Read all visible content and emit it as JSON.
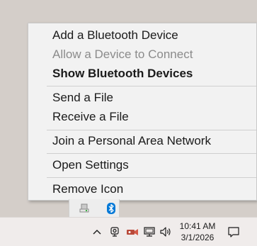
{
  "context_menu": {
    "items": [
      {
        "label": "Add a Bluetooth Device",
        "state": "enabled"
      },
      {
        "label": "Allow a Device to Connect",
        "state": "disabled"
      },
      {
        "label": "Show Bluetooth Devices",
        "state": "default"
      },
      {
        "label": "Send a File",
        "state": "enabled"
      },
      {
        "label": "Receive a File",
        "state": "enabled"
      },
      {
        "label": "Join a Personal Area Network",
        "state": "enabled"
      },
      {
        "label": "Open Settings",
        "state": "enabled"
      },
      {
        "label": "Remove Icon",
        "state": "enabled"
      }
    ]
  },
  "tray_popup": {
    "icons": [
      "usb-eject-icon",
      "bluetooth-icon"
    ]
  },
  "taskbar": {
    "tray_icons": [
      "chevron-up-icon",
      "camera-icon",
      "sound-recorder-icon",
      "network-icon",
      "volume-icon",
      "notification-icon"
    ],
    "clock": {
      "time": "10:41 AM",
      "date": "3/1/2026"
    }
  },
  "colors": {
    "desktop": "#d4cec9",
    "menu_background": "#f2f2f2",
    "disabled_text": "#8b8b8b",
    "bluetooth_blue": "#0078d7",
    "taskbar": "#f0eceb"
  }
}
